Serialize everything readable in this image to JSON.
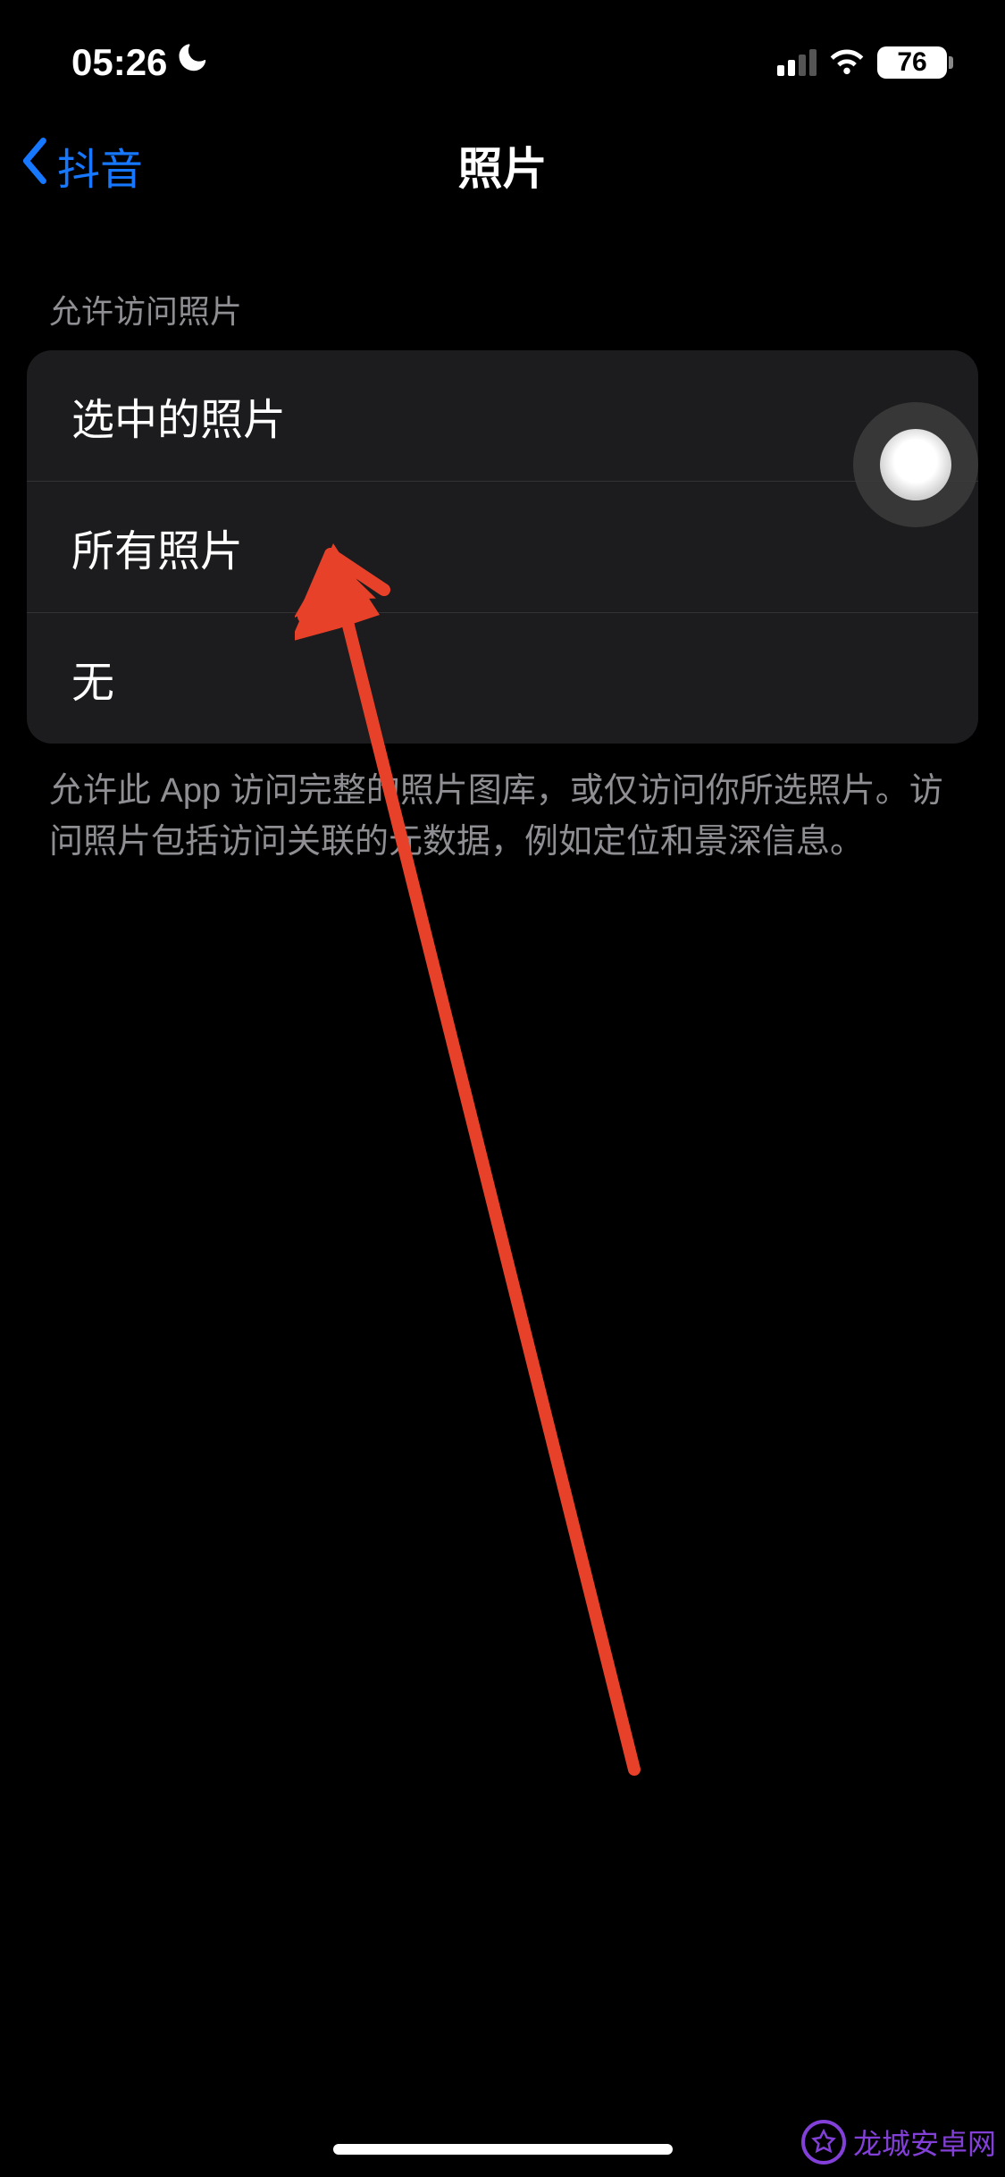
{
  "status": {
    "time": "05:26",
    "battery": "76"
  },
  "nav": {
    "back_label": "抖音",
    "title": "照片"
  },
  "section": {
    "header": "允许访问照片",
    "options": {
      "selected": "选中的照片",
      "all": "所有照片",
      "none": "无"
    },
    "footer": "允许此 App 访问完整的照片图库，或仅访问你所选照片。访问照片包括访问关联的元数据，例如定位和景深信息。"
  },
  "watermark": {
    "text": "龙城安卓网"
  }
}
